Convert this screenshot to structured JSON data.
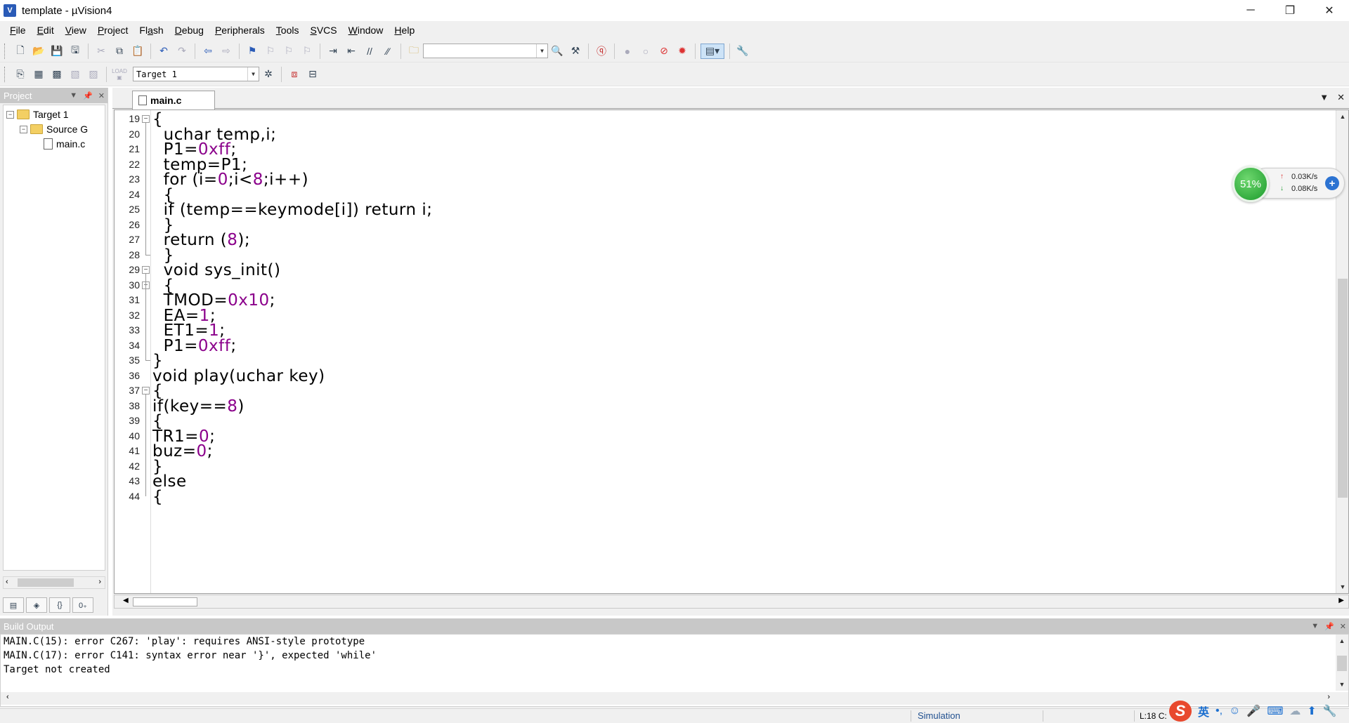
{
  "window": {
    "title": "template  - µVision4",
    "icon_letter": "V",
    "controls": [
      "─",
      "❐",
      "✕"
    ]
  },
  "menu": [
    {
      "label": "File",
      "u": "F",
      "rest": "ile"
    },
    {
      "label": "Edit",
      "u": "E",
      "rest": "dit"
    },
    {
      "label": "View",
      "u": "V",
      "rest": "iew"
    },
    {
      "label": "Project",
      "u": "P",
      "rest": "roject"
    },
    {
      "label": "Flash",
      "u": "a",
      "pre": "Fl",
      "rest": "sh"
    },
    {
      "label": "Debug",
      "u": "D",
      "rest": "ebug"
    },
    {
      "label": "Peripherals",
      "u": "P",
      "rest": "eripherals"
    },
    {
      "label": "Tools",
      "u": "T",
      "rest": "ools"
    },
    {
      "label": "SVCS",
      "u": "S",
      "rest": "VCS"
    },
    {
      "label": "Window",
      "u": "W",
      "rest": "indow"
    },
    {
      "label": "Help",
      "u": "H",
      "rest": "elp"
    }
  ],
  "toolbar": {
    "find_combo_value": "",
    "target_combo_value": "Target 1",
    "load_label": "LOAD"
  },
  "project_panel": {
    "title": "Project",
    "tree": [
      {
        "label": "Target 1",
        "level": 0,
        "expander": "−",
        "kind": "target"
      },
      {
        "label": "Source G",
        "level": 1,
        "expander": "−",
        "kind": "folder"
      },
      {
        "label": "main.c",
        "level": 2,
        "expander": "",
        "kind": "file"
      }
    ],
    "tabs": [
      "▤",
      "◈",
      "{}",
      "0₊"
    ]
  },
  "editor": {
    "tab_label": "main.c",
    "lines": [
      {
        "n": "19",
        "fold": "−",
        "code": [
          {
            "t": "{"
          }
        ]
      },
      {
        "n": "20",
        "code": [
          {
            "t": "  uchar temp,i;"
          }
        ]
      },
      {
        "n": "21",
        "code": [
          {
            "t": "  P1="
          },
          {
            "t": "0xff",
            "c": "num"
          },
          {
            "t": ";"
          }
        ]
      },
      {
        "n": "22",
        "code": [
          {
            "t": "  temp=P1;"
          }
        ]
      },
      {
        "n": "23",
        "code": [
          {
            "t": "  for (i="
          },
          {
            "t": "0",
            "c": "num"
          },
          {
            "t": ";i<"
          },
          {
            "t": "8",
            "c": "num"
          },
          {
            "t": ";i++)"
          }
        ]
      },
      {
        "n": "24",
        "code": [
          {
            "t": "  {"
          }
        ]
      },
      {
        "n": "25",
        "code": [
          {
            "t": "  if (temp==keymode[i]) return i;"
          }
        ]
      },
      {
        "n": "26",
        "code": [
          {
            "t": "  }"
          }
        ]
      },
      {
        "n": "27",
        "code": [
          {
            "t": "  return ("
          },
          {
            "t": "8",
            "c": "num"
          },
          {
            "t": ");"
          }
        ]
      },
      {
        "n": "28",
        "code": [
          {
            "t": "  }"
          }
        ]
      },
      {
        "n": "29",
        "fold": "−",
        "code": [
          {
            "t": "  void sys_init()"
          }
        ]
      },
      {
        "n": "30",
        "fold": "−",
        "code": [
          {
            "t": "  {"
          }
        ]
      },
      {
        "n": "31",
        "code": [
          {
            "t": "  TMOD="
          },
          {
            "t": "0x10",
            "c": "num"
          },
          {
            "t": ";"
          }
        ]
      },
      {
        "n": "32",
        "code": [
          {
            "t": "  EA="
          },
          {
            "t": "1",
            "c": "num"
          },
          {
            "t": ";"
          }
        ]
      },
      {
        "n": "33",
        "code": [
          {
            "t": "  ET1="
          },
          {
            "t": "1",
            "c": "num"
          },
          {
            "t": ";"
          }
        ]
      },
      {
        "n": "34",
        "code": [
          {
            "t": "  P1="
          },
          {
            "t": "0xff",
            "c": "num"
          },
          {
            "t": ";"
          }
        ]
      },
      {
        "n": "35",
        "code": [
          {
            "t": "}"
          }
        ]
      },
      {
        "n": "36",
        "code": [
          {
            "t": "void play(uchar key)"
          }
        ]
      },
      {
        "n": "37",
        "fold": "−",
        "code": [
          {
            "t": "{"
          }
        ]
      },
      {
        "n": "38",
        "code": [
          {
            "t": "if(key=="
          },
          {
            "t": "8",
            "c": "num"
          },
          {
            "t": ")"
          }
        ]
      },
      {
        "n": "39",
        "code": [
          {
            "t": "{"
          }
        ]
      },
      {
        "n": "40",
        "code": [
          {
            "t": "TR1="
          },
          {
            "t": "0",
            "c": "num"
          },
          {
            "t": ";"
          }
        ]
      },
      {
        "n": "41",
        "code": [
          {
            "t": "buz="
          },
          {
            "t": "0",
            "c": "num"
          },
          {
            "t": ";"
          }
        ]
      },
      {
        "n": "42",
        "code": [
          {
            "t": "}"
          }
        ]
      },
      {
        "n": "43",
        "code": [
          {
            "t": "else"
          }
        ]
      },
      {
        "n": "44",
        "code": [
          {
            "t": "{"
          }
        ]
      }
    ]
  },
  "net_widget": {
    "percent": "51%",
    "upload": "0.03K/s",
    "download": "0.08K/s"
  },
  "build_output": {
    "title": "Build Output",
    "lines": [
      "MAIN.C(15): error C267: 'play': requires ANSI-style prototype",
      "MAIN.C(17): error C141: syntax error near '}', expected 'while'",
      "Target not created"
    ]
  },
  "status": {
    "mode": "Simulation",
    "position": "L:18 C:"
  },
  "ime": {
    "logo": "S",
    "lang": "英",
    "icons": [
      "punct-icon",
      "emoji-icon",
      "mic-icon",
      "keyboard-icon",
      "skin-icon",
      "upload-icon",
      "wrench-icon"
    ]
  }
}
